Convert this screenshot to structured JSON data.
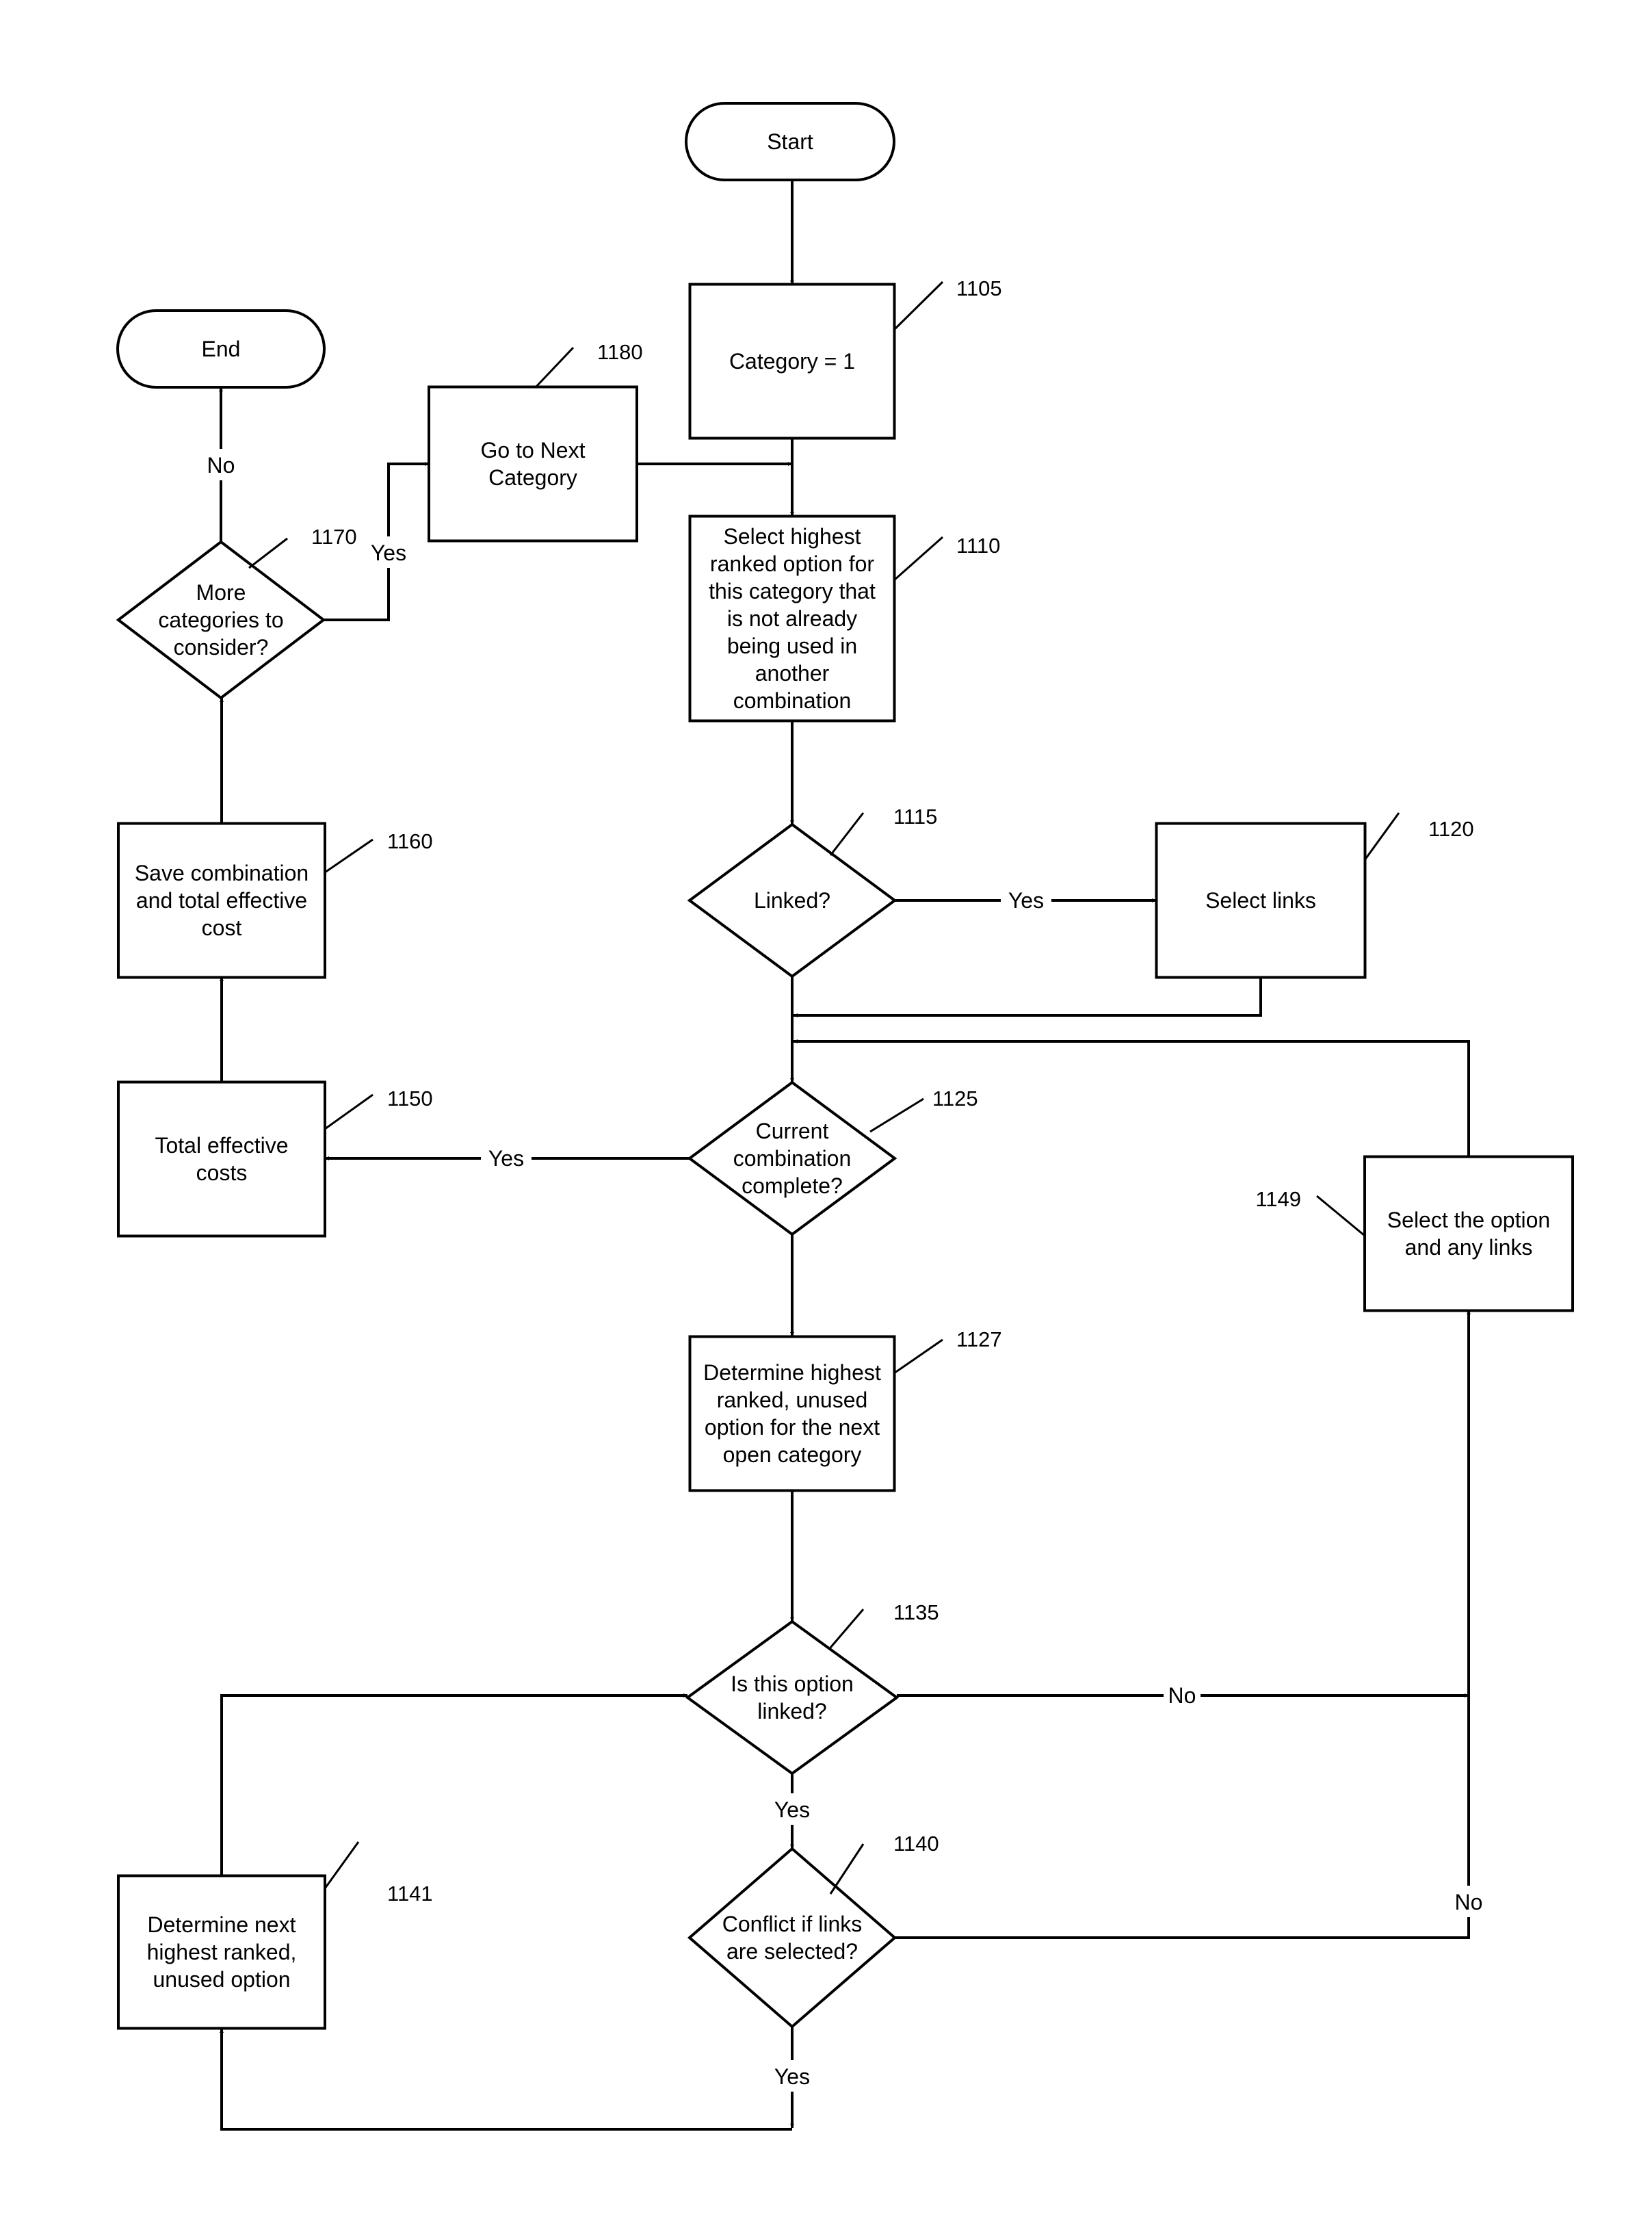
{
  "diagram": {
    "type": "flowchart",
    "colors": {
      "line": "#000000",
      "background": "#ffffff"
    },
    "nodes": [
      {
        "id": "start",
        "ref": "",
        "shape": "terminal",
        "lines": [
          "Start"
        ]
      },
      {
        "id": "n1105",
        "ref": "1105",
        "shape": "process",
        "lines": [
          "Category = 1"
        ]
      },
      {
        "id": "n1110",
        "ref": "1110",
        "shape": "process",
        "lines": [
          "Select highest",
          "ranked option for",
          "this category that",
          "is not already",
          "being used in",
          "another",
          "combination"
        ]
      },
      {
        "id": "n1115",
        "ref": "1115",
        "shape": "decision",
        "lines": [
          "Linked?"
        ]
      },
      {
        "id": "n1120",
        "ref": "1120",
        "shape": "process",
        "lines": [
          "Select links"
        ]
      },
      {
        "id": "n1125",
        "ref": "1125",
        "shape": "decision",
        "lines": [
          "Current",
          "combination",
          "complete?"
        ]
      },
      {
        "id": "n1127",
        "ref": "1127",
        "shape": "process",
        "lines": [
          "Determine highest",
          "ranked, unused",
          "option for the next",
          "open category"
        ]
      },
      {
        "id": "n1135",
        "ref": "1135",
        "shape": "decision",
        "lines": [
          "Is this option",
          "linked?"
        ]
      },
      {
        "id": "n1140",
        "ref": "1140",
        "shape": "decision",
        "lines": [
          "Conflict if links",
          "are selected?"
        ]
      },
      {
        "id": "n1141",
        "ref": "1141",
        "shape": "process",
        "lines": [
          "Determine next",
          "highest ranked,",
          "unused option"
        ]
      },
      {
        "id": "n1149",
        "ref": "1149",
        "shape": "process",
        "lines": [
          "Select the option",
          "and any links"
        ]
      },
      {
        "id": "n1150",
        "ref": "1150",
        "shape": "process",
        "lines": [
          "Total effective",
          "costs"
        ]
      },
      {
        "id": "n1160",
        "ref": "1160",
        "shape": "process",
        "lines": [
          "Save combination",
          "and total effective",
          "cost"
        ]
      },
      {
        "id": "n1170",
        "ref": "1170",
        "shape": "decision",
        "lines": [
          "More",
          "categories to",
          "consider?"
        ]
      },
      {
        "id": "n1180",
        "ref": "1180",
        "shape": "process",
        "lines": [
          "Go to Next",
          "Category"
        ]
      },
      {
        "id": "end",
        "ref": "",
        "shape": "terminal",
        "lines": [
          "End"
        ]
      }
    ],
    "edges": [
      {
        "from": "start",
        "to": "n1105",
        "label": ""
      },
      {
        "from": "n1105",
        "to": "n1110",
        "label": ""
      },
      {
        "from": "n1180",
        "to": "n1110",
        "label": ""
      },
      {
        "from": "n1110",
        "to": "n1115",
        "label": ""
      },
      {
        "from": "n1115",
        "to": "n1120",
        "label": "Yes"
      },
      {
        "from": "n1115",
        "to": "n1125",
        "label": ""
      },
      {
        "from": "n1120",
        "to": "n1125",
        "label": ""
      },
      {
        "from": "n1149",
        "to": "n1125",
        "label": ""
      },
      {
        "from": "n1125",
        "to": "n1150",
        "label": "Yes"
      },
      {
        "from": "n1125",
        "to": "n1127",
        "label": ""
      },
      {
        "from": "n1127",
        "to": "n1135",
        "label": ""
      },
      {
        "from": "n1135",
        "to": "n1149",
        "label": "No"
      },
      {
        "from": "n1135",
        "to": "n1140",
        "label": "Yes"
      },
      {
        "from": "n1140",
        "to": "n1149",
        "label": "No"
      },
      {
        "from": "n1140",
        "to": "n1141",
        "label": "Yes"
      },
      {
        "from": "n1141",
        "to": "n1135",
        "label": ""
      },
      {
        "from": "n1150",
        "to": "n1160",
        "label": ""
      },
      {
        "from": "n1160",
        "to": "n1170",
        "label": ""
      },
      {
        "from": "n1170",
        "to": "n1180",
        "label": "Yes"
      },
      {
        "from": "n1170",
        "to": "end",
        "label": "No"
      }
    ]
  }
}
